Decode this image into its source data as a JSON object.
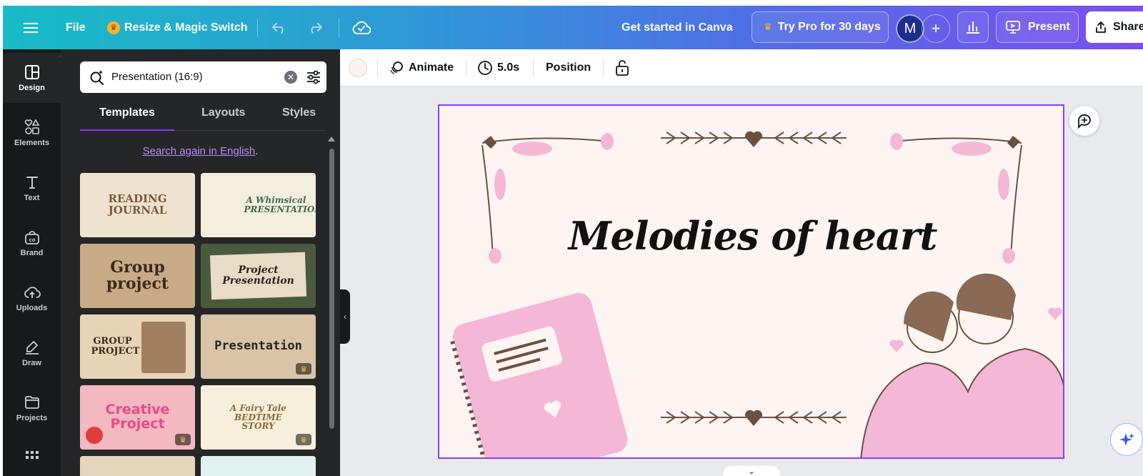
{
  "topbar": {
    "menu_icon": "hamburger-icon",
    "file_label": "File",
    "resize_label": "Resize & Magic Switch",
    "get_started": "Get started in Canva",
    "try_pro": "Try Pro for 30 days",
    "avatar_initial": "M",
    "plus_label": "+",
    "present_label": "Present",
    "share_label": "Share"
  },
  "rail": {
    "items": [
      {
        "label": "Design",
        "icon": "design-icon"
      },
      {
        "label": "Elements",
        "icon": "elements-icon"
      },
      {
        "label": "Text",
        "icon": "text-icon"
      },
      {
        "label": "Brand",
        "icon": "brand-icon"
      },
      {
        "label": "Uploads",
        "icon": "uploads-icon"
      },
      {
        "label": "Draw",
        "icon": "draw-icon"
      },
      {
        "label": "Projects",
        "icon": "projects-icon"
      }
    ]
  },
  "panel": {
    "search_value": "Presentation (16:9)",
    "tabs": [
      "Templates",
      "Layouts",
      "Styles"
    ],
    "search_again_link": "Search again in English",
    "search_again_suffix": ".",
    "templates": [
      {
        "title": "READING JOURNAL",
        "bg": "#efe2cf",
        "fg": "#7a5a3a",
        "pro": false
      },
      {
        "title": "A Whimsical PRESENTATION",
        "bg": "#f3efdc",
        "fg": "#3d6b4f",
        "pro": false
      },
      {
        "title": "Group project",
        "bg": "#c8ab86",
        "fg": "#3b2a1a",
        "pro": false
      },
      {
        "title": "Project Presentation",
        "bg": "#4a5a3e",
        "fg": "#2a2218",
        "pro": false
      },
      {
        "title": "GROUP PROJECT",
        "bg": "#e8d4b6",
        "fg": "#3b2a1a",
        "pro": false
      },
      {
        "title": "Presentation",
        "bg": "#d9c4a8",
        "fg": "#2a2218",
        "pro": true
      },
      {
        "title": "Creative Project",
        "bg": "#f4b8c0",
        "fg": "#e84a8a",
        "pro": true
      },
      {
        "title": "A Fairy Tale BEDTIME STORY",
        "bg": "#f7efdc",
        "fg": "#8a6a3a",
        "pro": true
      }
    ]
  },
  "toolbar": {
    "swatch_color": "#fdf2ee",
    "animate_label": "Animate",
    "duration_label": "5.0s",
    "position_label": "Position"
  },
  "slide": {
    "title": "Melodies of heart",
    "background": "#fef5f2",
    "accent_pink": "#f4b8d6",
    "accent_brown": "#6b5040"
  }
}
